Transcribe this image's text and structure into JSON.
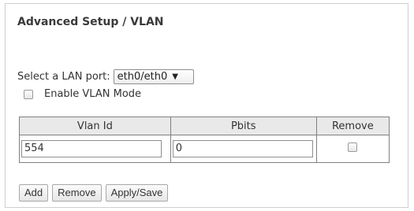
{
  "header": {
    "title": "Advanced Setup / VLAN"
  },
  "lan_port": {
    "label": "Select a LAN port:",
    "selected": "eth0/eth0",
    "caret": "▼"
  },
  "vlan_mode": {
    "label": "Enable VLAN Mode",
    "checked": false
  },
  "table": {
    "columns": [
      "Vlan Id",
      "Pbits",
      "Remove"
    ],
    "rows": [
      {
        "vlan_id": "554",
        "pbits": "0",
        "remove_checked": false
      }
    ]
  },
  "buttons": {
    "add": "Add",
    "remove": "Remove",
    "apply_save": "Apply/Save"
  }
}
